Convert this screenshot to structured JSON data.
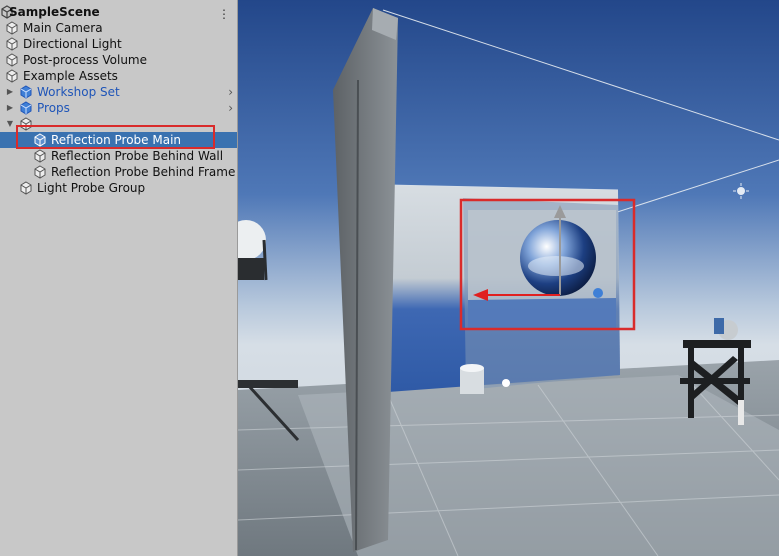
{
  "hierarchy": {
    "scene_name": "SampleScene",
    "menu_icon": "kebab-menu-icon",
    "items": [
      {
        "label": "Main Camera"
      },
      {
        "label": "Directional Light"
      },
      {
        "label": "Post-process Volume"
      },
      {
        "label": "Example Assets"
      },
      {
        "label": "Workshop Set"
      },
      {
        "label": "Props"
      },
      {
        "label": ""
      },
      {
        "label": "Reflection Probe Main"
      },
      {
        "label": "Reflection Probe Behind Wall"
      },
      {
        "label": "Reflection Probe Behind Frame"
      },
      {
        "label": "Light Probe Group"
      }
    ]
  },
  "colors": {
    "selection": "#3a72b0",
    "prefab_text": "#1f55b8",
    "highlight_box": "#d92b2b",
    "panel_bg": "#c8c8c8"
  }
}
